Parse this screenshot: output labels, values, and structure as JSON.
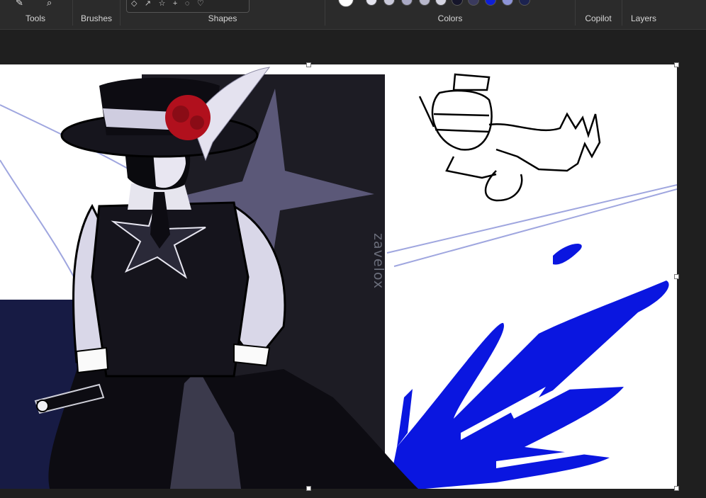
{
  "ribbon": {
    "groups": {
      "tools": "Tools",
      "brushes": "Brushes",
      "shapes": "Shapes",
      "colors": "Colors",
      "copilot": "Copilot",
      "layers": "Layers"
    },
    "swatches": [
      "#ffffff",
      "#e4e4ee",
      "#c9c9da",
      "#a9a9c4",
      "#b7b7cb",
      "#d5d5e2",
      "#15152a",
      "#3a3a5e",
      "#0e1fd6",
      "#8d94d8",
      "#1c2350"
    ]
  },
  "canvas": {
    "signature": "zavelox",
    "colors": {
      "navy": "#171b44",
      "dark_panel": "#1d1c24",
      "star": "#5b5878",
      "blue_splash": "#0a16e0",
      "rose": "#b1101d",
      "line_lilac": "#9fa6df"
    }
  }
}
